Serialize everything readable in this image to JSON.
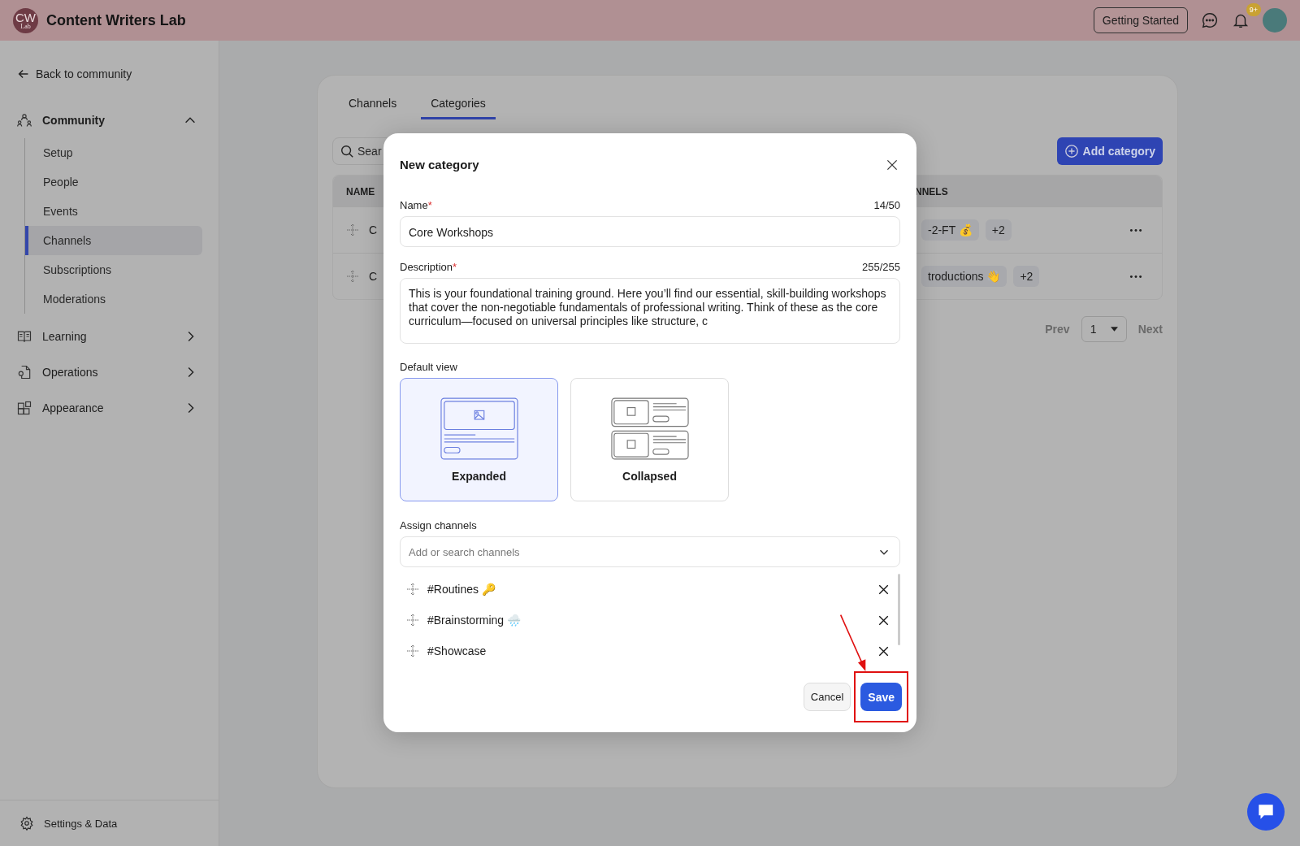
{
  "header": {
    "logo_initials": "CW",
    "logo_sub": "Lab",
    "title": "Content Writers Lab",
    "getting_started": "Getting Started",
    "notification_badge": "9+"
  },
  "sidebar": {
    "back": "Back to community",
    "sections": [
      {
        "label": "Community",
        "expanded": true,
        "children": [
          {
            "label": "Setup",
            "selected": false
          },
          {
            "label": "People",
            "selected": false
          },
          {
            "label": "Events",
            "selected": false
          },
          {
            "label": "Channels",
            "selected": true
          },
          {
            "label": "Subscriptions",
            "selected": false
          },
          {
            "label": "Moderations",
            "selected": false
          }
        ]
      },
      {
        "label": "Learning",
        "expanded": false
      },
      {
        "label": "Operations",
        "expanded": false
      },
      {
        "label": "Appearance",
        "expanded": false
      }
    ],
    "footer": "Settings & Data"
  },
  "page": {
    "tabs": [
      {
        "label": "Channels",
        "selected": false
      },
      {
        "label": "Categories",
        "selected": true
      }
    ],
    "search_placeholder": "Sear",
    "add_button": "Add category",
    "table": {
      "columns": [
        "NAME",
        "NNELS"
      ],
      "rows": [
        {
          "name": "C",
          "channel": "-2-FT 💰",
          "more": "+2"
        },
        {
          "name": "C",
          "channel": "troductions 👋",
          "more": "+2"
        }
      ]
    },
    "pagination": {
      "prev": "Prev",
      "page": "1",
      "next": "Next"
    }
  },
  "modal": {
    "title": "New category",
    "name": {
      "label": "Name",
      "mark": "*",
      "count": "14/50",
      "value": "Core Workshops"
    },
    "description": {
      "label": "Description",
      "mark": "*",
      "count": "255/255",
      "value": "This is your foundational training ground. Here you’ll find our essential, skill-building workshops that cover the non-negotiable fundamentals of professional writing. Think of these as the core curriculum—focused on universal principles like structure, c"
    },
    "default_view": {
      "label": "Default view",
      "options": [
        {
          "label": "Expanded",
          "kind": "expanded",
          "selected": true
        },
        {
          "label": "Collapsed",
          "kind": "collapsed",
          "selected": false
        }
      ]
    },
    "assign": {
      "label": "Assign channels",
      "placeholder": "Add or search channels",
      "channels": [
        {
          "name": "#Routines 🔑"
        },
        {
          "name": "#Brainstorming 🌧️"
        },
        {
          "name": "#Showcase"
        }
      ]
    },
    "cancel": "Cancel",
    "save": "Save"
  }
}
